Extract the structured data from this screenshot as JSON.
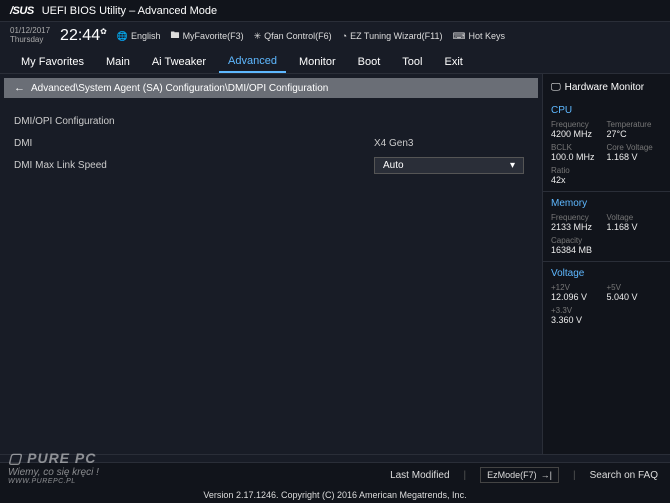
{
  "header": {
    "brand": "/SUS",
    "title": "UEFI BIOS Utility – Advanced Mode"
  },
  "info": {
    "date": "01/12/2017",
    "day": "Thursday",
    "time": "22:44",
    "language": "English",
    "myfav": "MyFavorite(F3)",
    "qfan": "Qfan Control(F6)",
    "eztune": "EZ Tuning Wizard(F11)",
    "hotkeys": "Hot Keys"
  },
  "tabs": {
    "items": [
      "My Favorites",
      "Main",
      "Ai Tweaker",
      "Advanced",
      "Monitor",
      "Boot",
      "Tool",
      "Exit"
    ],
    "active": 3
  },
  "breadcrumb": "Advanced\\System Agent (SA) Configuration\\DMI/OPI Configuration",
  "settings": {
    "section_title": "DMI/OPI Configuration",
    "rows": [
      {
        "label": "DMI",
        "value": "X4  Gen3",
        "type": "text"
      },
      {
        "label": "DMI Max Link Speed",
        "value": "Auto",
        "type": "dropdown"
      }
    ]
  },
  "sidebar": {
    "title": "Hardware Monitor",
    "cpu": {
      "title": "CPU",
      "freq_lbl": "Frequency",
      "freq": "4200 MHz",
      "temp_lbl": "Temperature",
      "temp": "27°C",
      "bclk_lbl": "BCLK",
      "bclk": "100.0 MHz",
      "cvolt_lbl": "Core Voltage",
      "cvolt": "1.168 V",
      "ratio_lbl": "Ratio",
      "ratio": "42x"
    },
    "mem": {
      "title": "Memory",
      "freq_lbl": "Frequency",
      "freq": "2133 MHz",
      "volt_lbl": "Voltage",
      "volt": "1.168 V",
      "cap_lbl": "Capacity",
      "cap": "16384 MB"
    },
    "volt": {
      "title": "Voltage",
      "v12_lbl": "+12V",
      "v12": "12.096 V",
      "v5_lbl": "+5V",
      "v5": "5.040 V",
      "v33_lbl": "+3.3V",
      "v33": "3.360 V"
    }
  },
  "footer": {
    "lastmod": "Last Modified",
    "ezmode": "EzMode(F7)",
    "search": "Search on FAQ",
    "version": "Version 2.17.1246. Copyright (C) 2016 American Megatrends, Inc."
  },
  "watermark": {
    "brand": "PURE PC",
    "tag": "Wiemy, co się kręci !",
    "url": "WWW.PUREPC.PL"
  }
}
